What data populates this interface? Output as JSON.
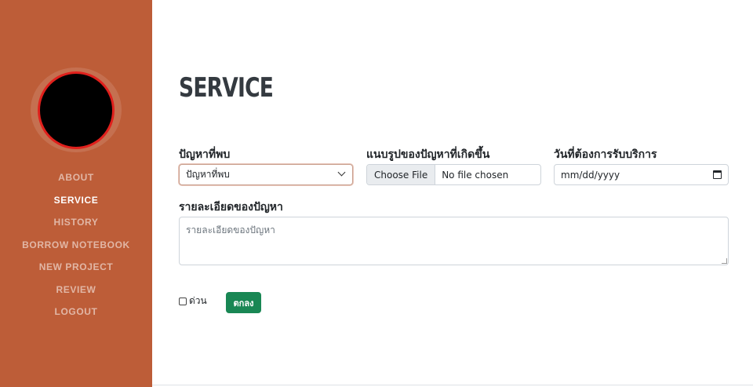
{
  "sidebar": {
    "nav": [
      {
        "label": "ABOUT"
      },
      {
        "label": "SERVICE"
      },
      {
        "label": "HISTORY"
      },
      {
        "label": "BORROW NOTEBOOK"
      },
      {
        "label": "NEW PROJECT"
      },
      {
        "label": "REVIEW"
      },
      {
        "label": "LOGOUT"
      }
    ],
    "active_item": "SERVICE"
  },
  "main": {
    "title": "SERVICE",
    "problem": {
      "label": "ปัญหาที่พบ",
      "selected": "ปัญหาที่พบ"
    },
    "attachment": {
      "label": "แนบรูปของปัญหาที่เกิดขึ้น",
      "button": "Choose File",
      "status": "No file chosen"
    },
    "date": {
      "label": "วันที่ต้องการรับบริการ",
      "placeholder": "mm/dd/yyyy"
    },
    "details": {
      "label": "รายละเอียดของปัญหา",
      "placeholder": "รายละเอียดของปัญหา"
    },
    "urgent": {
      "label": "ด่วน",
      "checked": false
    },
    "submit": {
      "label": "ตกลง"
    }
  },
  "colors": {
    "sidebar": "#bd5d38",
    "submit": "#198754",
    "title": "#343a40"
  }
}
